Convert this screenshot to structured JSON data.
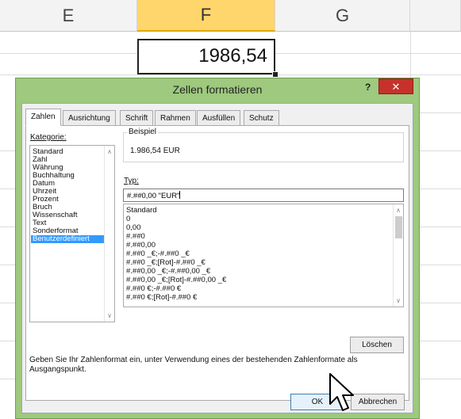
{
  "sheet": {
    "columns": [
      "E",
      "F",
      "G"
    ],
    "selected_column": "F",
    "active_cell_value": "1986,54"
  },
  "dialog": {
    "title": "Zellen formatieren",
    "help": "?",
    "close": "✕",
    "tabs": [
      "Zahlen",
      "Ausrichtung",
      "Schrift",
      "Rahmen",
      "Ausfüllen",
      "Schutz"
    ],
    "active_tab": "Zahlen",
    "kategorie_label": "Kategorie:",
    "kategorien": [
      "Standard",
      "Zahl",
      "Währung",
      "Buchhaltung",
      "Datum",
      "Uhrzeit",
      "Prozent",
      "Bruch",
      "Wissenschaft",
      "Text",
      "Sonderformat",
      "Benutzerdefiniert"
    ],
    "selected_kategorie": "Benutzerdefiniert",
    "beispiel_label": "Beispiel",
    "beispiel_value": "1.986,54 EUR",
    "typ_label": "Typ:",
    "typ_value": "#.##0,00 \"EUR\"",
    "typ_options": [
      "Standard",
      "0",
      "0,00",
      "#.##0",
      "#.##0,00",
      "#.##0 _€;-#.##0 _€",
      "#.##0 _€;[Rot]-#.##0 _€",
      "#.##0,00 _€;-#.##0,00 _€",
      "#.##0,00 _€;[Rot]-#.##0,00 _€",
      "#.##0 €;-#.##0 €",
      "#.##0 €;[Rot]-#.##0 €"
    ],
    "loeschen_label": "Löschen",
    "description": "Geben Sie Ihr Zahlenformat ein, unter Verwendung eines der bestehenden Zahlenformate als Ausgangspunkt.",
    "ok_label": "OK",
    "abbrechen_label": "Abbrechen"
  },
  "colors": {
    "dialog_frame": "#9ec97e",
    "selected_header": "#ffd66b",
    "selection_blue": "#3399ff",
    "close_red": "#c7312c"
  }
}
